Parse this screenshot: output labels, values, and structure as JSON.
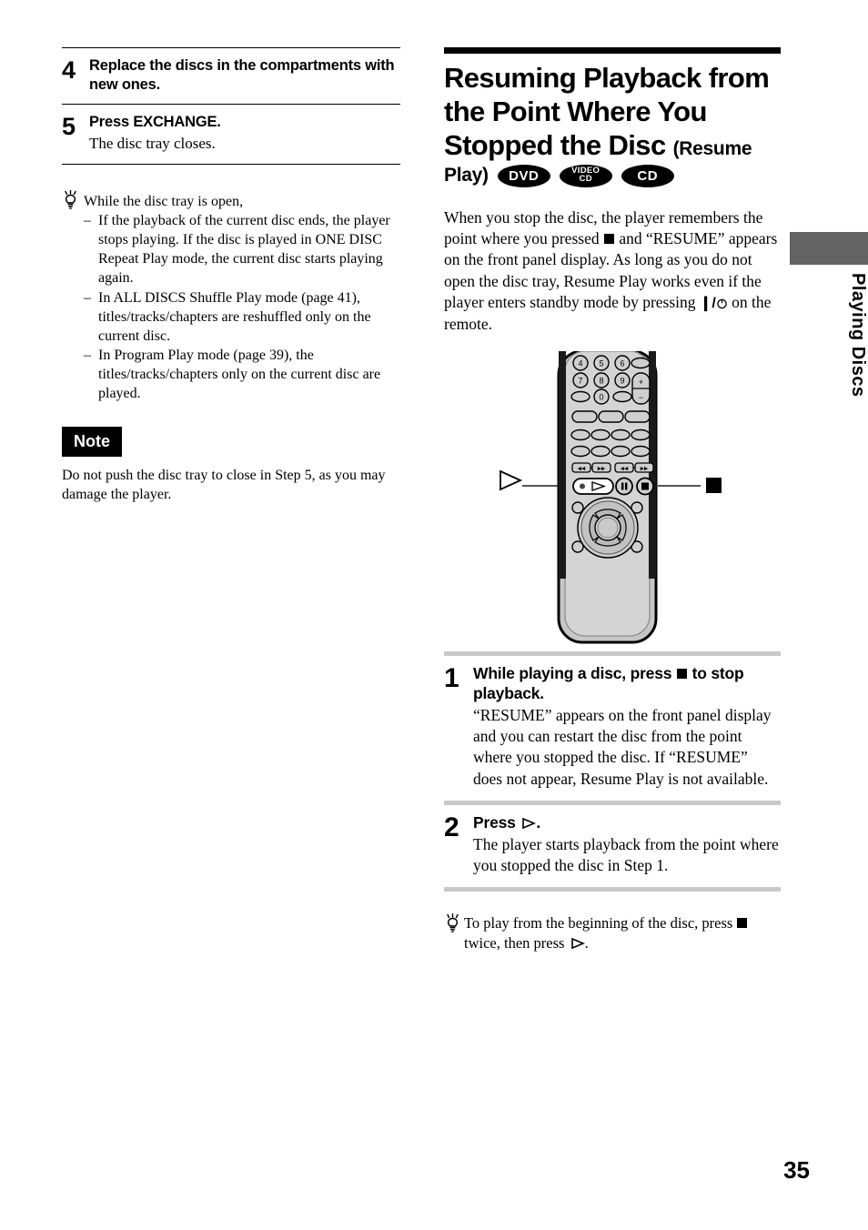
{
  "left_column": {
    "steps": [
      {
        "number": "4",
        "title": "Replace the discs in the compartments with new ones.",
        "desc": ""
      },
      {
        "number": "5",
        "title": "Press EXCHANGE.",
        "desc": "The disc tray closes."
      }
    ],
    "tip": {
      "icon": "lightbulb-tip-icon",
      "intro": "While the disc tray is open,",
      "dash": "–",
      "items": [
        "If the playback of the current disc ends, the player stops playing. If the disc is played in ONE DISC Repeat Play mode, the current disc starts playing again.",
        "In ALL DISCS Shuffle Play mode (page 41), titles/tracks/chapters are reshuffled only on the current disc.",
        "In Program Play mode (page 39), the titles/tracks/chapters only on the current disc are played."
      ]
    },
    "note": {
      "badge": "Note",
      "text": "Do not push the disc tray to close in Step 5, as you may damage the player."
    }
  },
  "right_column": {
    "heading_main": "Resuming Playback from the Point Where You Stopped the Disc",
    "heading_sub_open": "(Resume",
    "heading_sub_close": "Play)",
    "disc_badges": [
      {
        "id": "dvd-badge",
        "label": "DVD"
      },
      {
        "id": "video-cd-badge",
        "label_top": "VIDEO",
        "label_bottom": "CD"
      },
      {
        "id": "cd-badge",
        "label": "CD"
      }
    ],
    "intro_parts": {
      "p1": "When you stop the disc, the player remembers the point where you pressed ",
      "p2": " and “RESUME” appears on the front panel display. As long as you do not open the disc tray, Resume Play works even if the player enters standby mode by pressing ",
      "standby_symbol": "1/",
      "p3": " on the remote."
    },
    "figure": {
      "name": "remote-control-illustration",
      "callout_left": "play-button-callout",
      "callout_right": "stop-button-callout",
      "keypad_rows": [
        [
          "4",
          "5",
          "6"
        ],
        [
          "7",
          "8",
          "9"
        ],
        [
          "",
          "0",
          ""
        ]
      ],
      "volume_plus": "+",
      "volume_minus": "–"
    },
    "steps": [
      {
        "number": "1",
        "title_a": "While playing a disc, press ",
        "title_b": " to stop playback.",
        "desc": "“RESUME” appears on the front panel display and you can restart the disc from the point where you stopped the disc. If “RESUME” does not appear, Resume Play is not available."
      },
      {
        "number": "2",
        "title_a": "Press ",
        "title_b": ".",
        "desc": "The player starts playback from the point where you stopped the disc in Step 1."
      }
    ],
    "tip": {
      "icon": "lightbulb-tip-icon",
      "text_a": "To play from the beginning of the disc, press ",
      "text_b": " twice, then press ",
      "text_c": "."
    }
  },
  "side_tab": {
    "label": "Playing Discs",
    "color": "#636363"
  },
  "footer": {
    "page_number": "35"
  }
}
